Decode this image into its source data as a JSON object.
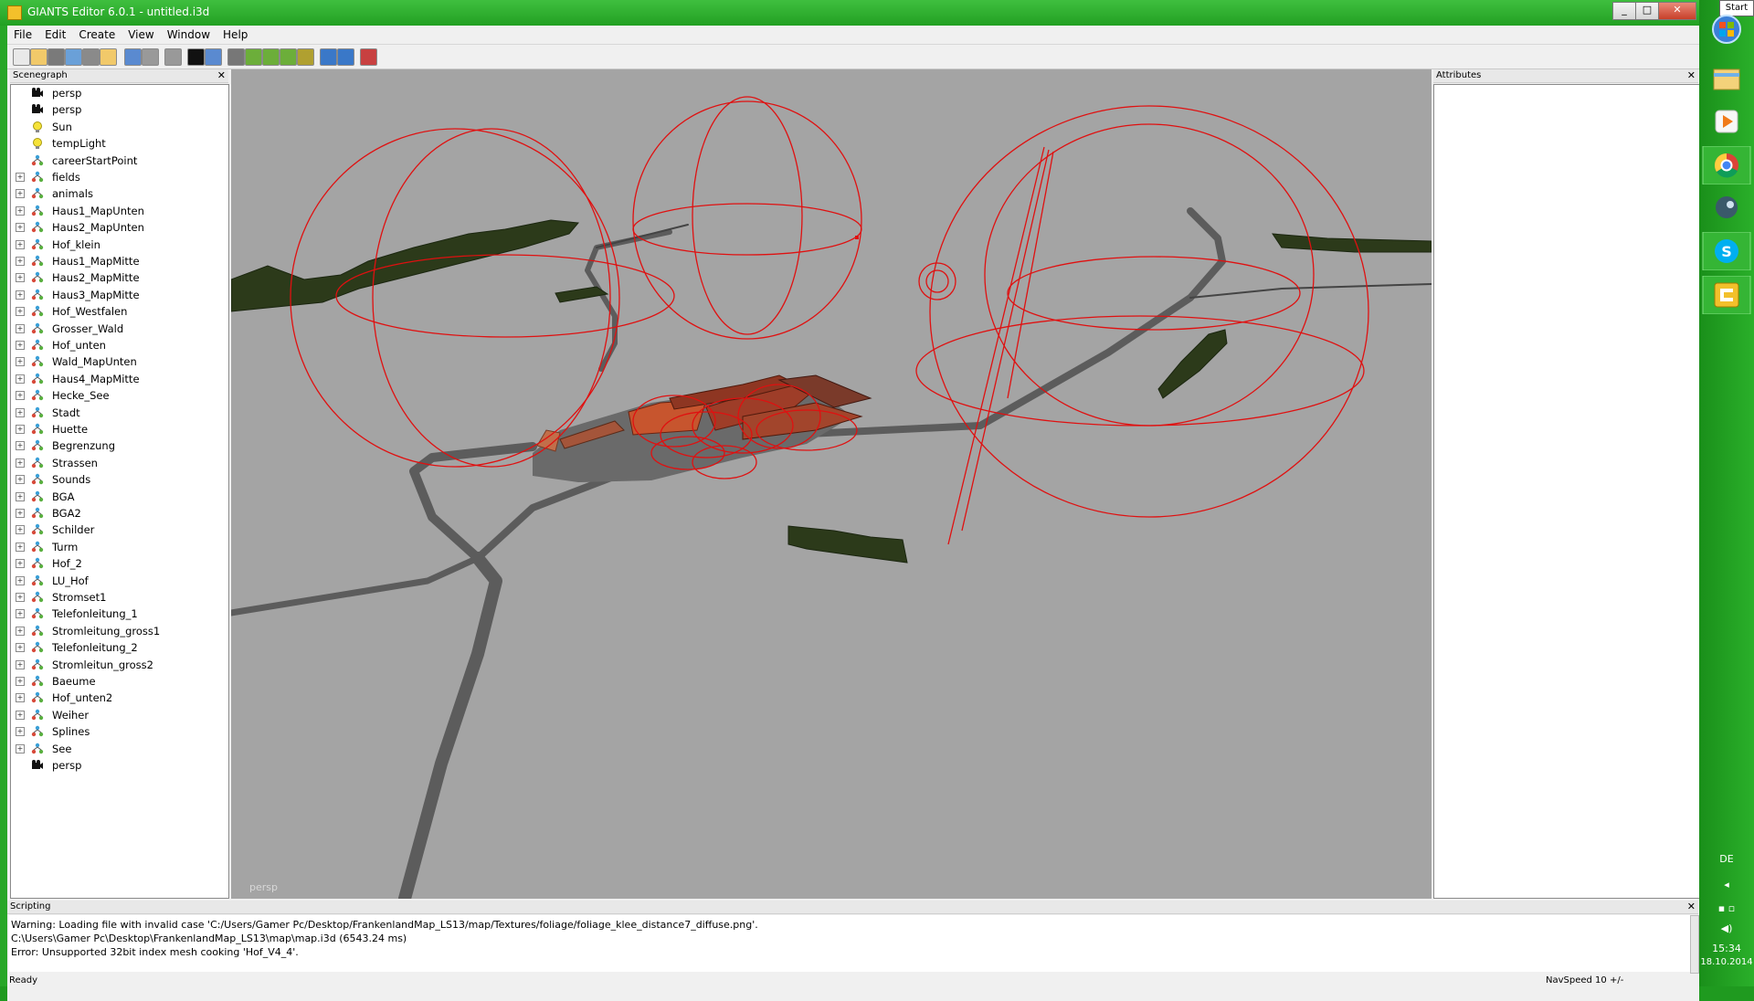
{
  "window": {
    "title": "GIANTS Editor 6.0.1 - untitled.i3d",
    "minimize": "_",
    "maximize": "□",
    "close": "✕"
  },
  "menu": [
    "File",
    "Edit",
    "Create",
    "View",
    "Window",
    "Help"
  ],
  "toolbar_icons": [
    "new-icon",
    "open-icon",
    "delete-icon",
    "refresh-icon",
    "save-icon",
    "open-folder-icon",
    "undo-history-icon",
    "undo-icon",
    "redo-icon",
    "play-icon",
    "camera-view-icon",
    "magnet-icon",
    "terrain-raise-icon",
    "terrain-lower-icon",
    "terrain-smooth-icon",
    "terrain-paint-icon",
    "rotate-icon",
    "settings-icon",
    "record-icon"
  ],
  "scenegraph": {
    "title": "Scenegraph",
    "close": "✕",
    "items": [
      {
        "label": "persp",
        "icon": "camera-icon",
        "expandable": false
      },
      {
        "label": "persp",
        "icon": "camera-icon",
        "expandable": false
      },
      {
        "label": "Sun",
        "icon": "light-icon",
        "expandable": false
      },
      {
        "label": "tempLight",
        "icon": "light-icon",
        "expandable": false
      },
      {
        "label": "careerStartPoint",
        "icon": "transform-group-icon",
        "expandable": false
      },
      {
        "label": "fields",
        "icon": "transform-group-icon",
        "expandable": true
      },
      {
        "label": "animals",
        "icon": "transform-group-icon",
        "expandable": true
      },
      {
        "label": "Haus1_MapUnten",
        "icon": "transform-group-icon",
        "expandable": true
      },
      {
        "label": "Haus2_MapUnten",
        "icon": "transform-group-icon",
        "expandable": true
      },
      {
        "label": "Hof_klein",
        "icon": "transform-group-icon",
        "expandable": true
      },
      {
        "label": "Haus1_MapMitte",
        "icon": "transform-group-icon",
        "expandable": true
      },
      {
        "label": "Haus2_MapMitte",
        "icon": "transform-group-icon",
        "expandable": true
      },
      {
        "label": "Haus3_MapMitte",
        "icon": "transform-group-icon",
        "expandable": true
      },
      {
        "label": "Hof_Westfalen",
        "icon": "transform-group-icon",
        "expandable": true
      },
      {
        "label": "Grosser_Wald",
        "icon": "transform-group-icon",
        "expandable": true
      },
      {
        "label": "Hof_unten",
        "icon": "transform-group-icon",
        "expandable": true
      },
      {
        "label": "Wald_MapUnten",
        "icon": "transform-group-icon",
        "expandable": true
      },
      {
        "label": "Haus4_MapMitte",
        "icon": "transform-group-icon",
        "expandable": true
      },
      {
        "label": "Hecke_See",
        "icon": "transform-group-icon",
        "expandable": true
      },
      {
        "label": "Stadt",
        "icon": "transform-group-icon",
        "expandable": true
      },
      {
        "label": "Huette",
        "icon": "transform-group-icon",
        "expandable": true
      },
      {
        "label": "Begrenzung",
        "icon": "transform-group-icon",
        "expandable": true
      },
      {
        "label": "Strassen",
        "icon": "transform-group-icon",
        "expandable": true
      },
      {
        "label": "Sounds",
        "icon": "transform-group-icon",
        "expandable": true
      },
      {
        "label": "BGA",
        "icon": "transform-group-icon",
        "expandable": true
      },
      {
        "label": "BGA2",
        "icon": "transform-group-icon",
        "expandable": true
      },
      {
        "label": "Schilder",
        "icon": "transform-group-icon",
        "expandable": true
      },
      {
        "label": "Turm",
        "icon": "transform-group-icon",
        "expandable": true
      },
      {
        "label": "Hof_2",
        "icon": "transform-group-icon",
        "expandable": true
      },
      {
        "label": "LU_Hof",
        "icon": "transform-group-icon",
        "expandable": true
      },
      {
        "label": "Stromset1",
        "icon": "transform-group-icon",
        "expandable": true
      },
      {
        "label": "Telefonleitung_1",
        "icon": "transform-group-icon",
        "expandable": true
      },
      {
        "label": "Stromleitung_gross1",
        "icon": "transform-group-icon",
        "expandable": true
      },
      {
        "label": "Telefonleitung_2",
        "icon": "transform-group-icon",
        "expandable": true
      },
      {
        "label": "Stromleitun_gross2",
        "icon": "transform-group-icon",
        "expandable": true
      },
      {
        "label": "Baeume",
        "icon": "transform-group-icon",
        "expandable": true
      },
      {
        "label": "Hof_unten2",
        "icon": "transform-group-icon",
        "expandable": true
      },
      {
        "label": "Weiher",
        "icon": "transform-group-icon",
        "expandable": true
      },
      {
        "label": "Splines",
        "icon": "transform-group-icon",
        "expandable": true
      },
      {
        "label": "See",
        "icon": "transform-group-icon",
        "expandable": true
      },
      {
        "label": "persp",
        "icon": "camera-icon",
        "expandable": false
      }
    ]
  },
  "viewport": {
    "camera_label": "persp",
    "background": "#a4a4a4"
  },
  "attributes": {
    "title": "Attributes",
    "close": "✕"
  },
  "scripting": {
    "title": "Scripting",
    "close": "✕",
    "lines": [
      "Warning: Loading file with invalid case 'C:/Users/Gamer Pc/Desktop/FrankenlandMap_LS13/map/Textures/foliage/foliage_klee_distance7_diffuse.png'.",
      "C:\\Users\\Gamer Pc\\Desktop\\FrankenlandMap_LS13\\map\\map.i3d (6543.24 ms)",
      "Error: Unsupported 32bit index mesh cooking 'Hof_V4_4'."
    ]
  },
  "statusbar": {
    "left": "Ready",
    "right": "NavSpeed 10 +/-"
  },
  "taskbar": {
    "start_label": "Start",
    "apps": [
      "start-orb-icon",
      "file-explorer-icon",
      "media-player-icon",
      "chrome-icon",
      "steam-icon",
      "skype-icon",
      "giants-editor-icon"
    ],
    "language": "DE",
    "time": "15:34",
    "date": "18.10.2014"
  },
  "colors": {
    "accent_green": "#1f9a1f",
    "selection_red": "#e01010",
    "road_gray": "#5a5a5a",
    "tree_dark": "#2c3a1a"
  }
}
